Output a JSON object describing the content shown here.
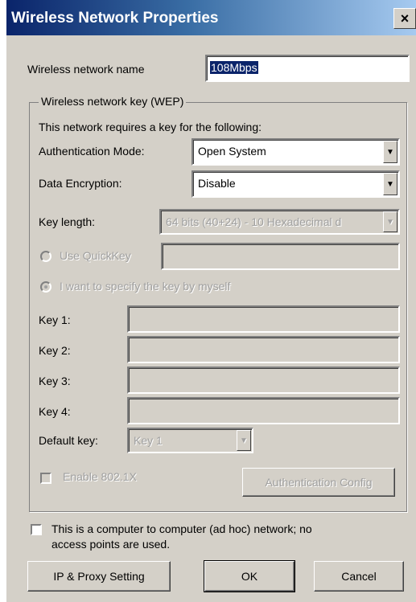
{
  "window": {
    "title": "Wireless Network Properties",
    "close_glyph": "×"
  },
  "network_name": {
    "label": "Wireless network name",
    "value": "108Mbps"
  },
  "wep_group": {
    "legend": "Wireless network key (WEP)",
    "intro": "This network requires a key for the following:",
    "auth_mode": {
      "label": "Authentication Mode:",
      "value": "Open System"
    },
    "encryption": {
      "label": "Data Encryption:",
      "value": "Disable"
    },
    "key_length": {
      "label": "Key length:",
      "value": "64 bits (40+24) - 10 Hexadecimal d"
    },
    "quickkey": {
      "label": "Use QuickKey"
    },
    "specify": {
      "label": "I want to specify the key by myself"
    },
    "keys": [
      {
        "label": "Key 1:"
      },
      {
        "label": "Key 2:"
      },
      {
        "label": "Key 3:"
      },
      {
        "label": "Key 4:"
      }
    ],
    "default_key": {
      "label": "Default key:",
      "value": "Key 1"
    },
    "enable_8021x": {
      "label": "Enable 802.1X"
    },
    "auth_config_button": "Authentication Config"
  },
  "adhoc": {
    "label_line1": "This is a computer to computer (ad hoc) network; no",
    "label_line2": "access points are used."
  },
  "buttons": {
    "ip_proxy": "IP & Proxy Setting",
    "ok": "OK",
    "cancel": "Cancel"
  },
  "colors": {
    "titlebar_start": "#0a246a",
    "titlebar_end": "#a6caf0",
    "face": "#d4d0c8"
  }
}
